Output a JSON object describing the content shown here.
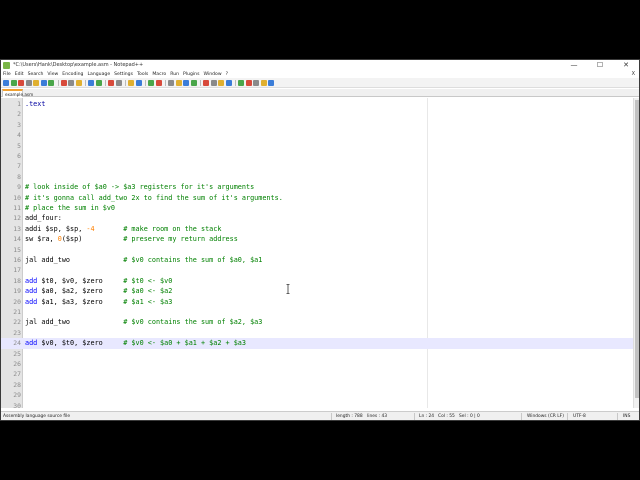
{
  "window": {
    "title": "*C:\\Users\\Hank\\Desktop\\example.asm - Notepad++",
    "min_glyph": "—",
    "max_glyph": "☐",
    "close_glyph": "✕"
  },
  "menu": {
    "items": [
      "File",
      "Edit",
      "Search",
      "View",
      "Encoding",
      "Language",
      "Settings",
      "Tools",
      "Macro",
      "Run",
      "Plugins",
      "Window",
      "?"
    ],
    "close_glyph": "X"
  },
  "toolbar": {
    "icons": [
      "new-file-icon",
      "open-file-icon",
      "save-icon",
      "save-all-icon",
      "close-icon",
      "close-all-icon",
      "print-icon",
      "cut-icon",
      "copy-icon",
      "paste-icon",
      "undo-icon",
      "redo-icon",
      "find-icon",
      "replace-icon",
      "zoom-in-icon",
      "zoom-out-icon",
      "sync-v-icon",
      "sync-h-icon",
      "wrap-icon",
      "all-chars-icon",
      "indent-guide-icon",
      "lang-icon",
      "doc-map-icon",
      "func-list-icon",
      "folder-icon",
      "monitor-icon",
      "record-icon",
      "stop-icon",
      "play-icon",
      "play-multi-icon",
      "save-macro-icon"
    ],
    "colors": {
      "blue": "#3b7dd8",
      "green": "#4aa64a",
      "red": "#d84a3b",
      "gray": "#8a8a8a",
      "yellow": "#e0b030"
    }
  },
  "tab": {
    "label": "example.asm"
  },
  "editor": {
    "current_line": 24,
    "lines": [
      {
        "n": "1",
        "segs": [
          {
            "t": ".text",
            "c": "dir"
          }
        ]
      },
      {
        "n": "2",
        "segs": []
      },
      {
        "n": "3",
        "segs": []
      },
      {
        "n": "4",
        "segs": []
      },
      {
        "n": "5",
        "segs": []
      },
      {
        "n": "6",
        "segs": []
      },
      {
        "n": "7",
        "segs": []
      },
      {
        "n": "8",
        "segs": []
      },
      {
        "n": "9",
        "segs": [
          {
            "t": "# look inside of $a0 -> $a3 registers for it's arguments",
            "c": "cmt"
          }
        ]
      },
      {
        "n": "10",
        "segs": [
          {
            "t": "# it's gonna call add_two 2x to find the sum of it's arguments.",
            "c": "cmt"
          }
        ]
      },
      {
        "n": "11",
        "segs": [
          {
            "t": "# place the sum in $v0",
            "c": "cmt"
          }
        ]
      },
      {
        "n": "12",
        "segs": [
          {
            "t": "add_four:",
            "c": ""
          }
        ]
      },
      {
        "n": "13",
        "segs": [
          {
            "t": "addi $sp, $sp, ",
            "c": ""
          },
          {
            "t": "-4",
            "c": "num"
          },
          {
            "t": "       ",
            "c": ""
          },
          {
            "t": "# make room on the stack",
            "c": "cmt"
          }
        ]
      },
      {
        "n": "14",
        "segs": [
          {
            "t": "sw $ra, ",
            "c": ""
          },
          {
            "t": "0",
            "c": "num"
          },
          {
            "t": "($sp)          ",
            "c": ""
          },
          {
            "t": "# preserve my return address",
            "c": "cmt"
          }
        ]
      },
      {
        "n": "15",
        "segs": []
      },
      {
        "n": "16",
        "segs": [
          {
            "t": "jal add_two             ",
            "c": ""
          },
          {
            "t": "# $v0 contains the sum of $a0, $a1",
            "c": "cmt"
          }
        ]
      },
      {
        "n": "17",
        "segs": []
      },
      {
        "n": "18",
        "segs": [
          {
            "t": "add",
            "c": "kw"
          },
          {
            "t": " $t0, $v0, $zero     ",
            "c": ""
          },
          {
            "t": "# $t0 <- $v0",
            "c": "cmt"
          }
        ]
      },
      {
        "n": "19",
        "segs": [
          {
            "t": "add",
            "c": "kw"
          },
          {
            "t": " $a0, $a2, $zero     ",
            "c": ""
          },
          {
            "t": "# $a0 <- $a2",
            "c": "cmt"
          }
        ]
      },
      {
        "n": "20",
        "segs": [
          {
            "t": "add",
            "c": "kw"
          },
          {
            "t": " $a1, $a3, $zero     ",
            "c": ""
          },
          {
            "t": "# $a1 <- $a3",
            "c": "cmt"
          }
        ]
      },
      {
        "n": "21",
        "segs": []
      },
      {
        "n": "22",
        "segs": [
          {
            "t": "jal add_two             ",
            "c": ""
          },
          {
            "t": "# $v0 contains the sum of $a2, $a3",
            "c": "cmt"
          }
        ]
      },
      {
        "n": "23",
        "segs": []
      },
      {
        "n": "24",
        "segs": [
          {
            "t": "add",
            "c": "kw"
          },
          {
            "t": " $v0, $t0, $zero     ",
            "c": ""
          },
          {
            "t": "# $v0 <- $a0 + $a1 + $a2 + $a3",
            "c": "cmt"
          }
        ]
      },
      {
        "n": "25",
        "segs": []
      },
      {
        "n": "26",
        "segs": []
      },
      {
        "n": "27",
        "segs": []
      },
      {
        "n": "28",
        "segs": []
      },
      {
        "n": "29",
        "segs": []
      },
      {
        "n": "30",
        "segs": []
      }
    ]
  },
  "status": {
    "filetype": "Assembly language source file",
    "length": "length : 788",
    "lines": "lines : 43",
    "ln": "Ln : 24",
    "col": "Col : 55",
    "sel": "Sel : 0 | 0",
    "eol": "Windows (CR LF)",
    "encoding": "UTF-8",
    "mode": "INS"
  }
}
